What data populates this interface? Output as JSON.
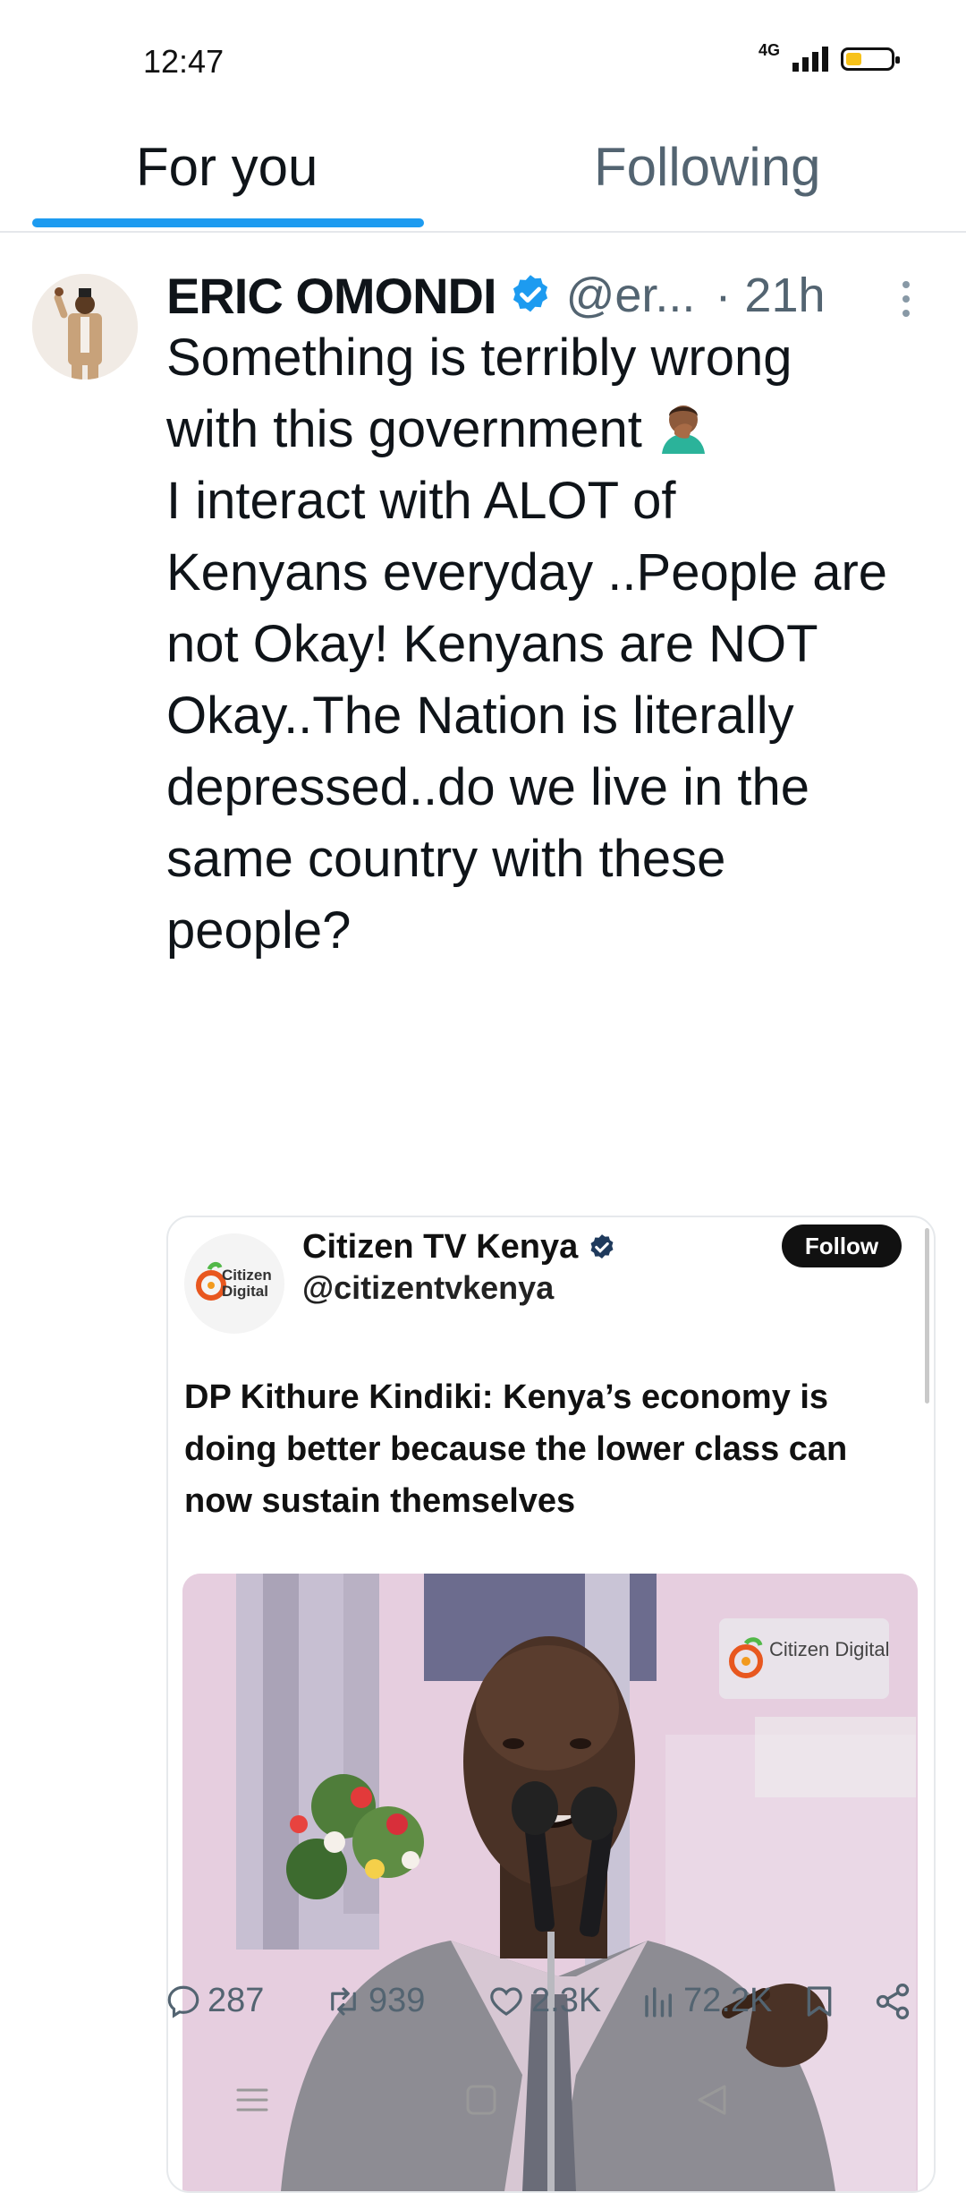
{
  "status_bar": {
    "time": "12:47",
    "network": "4G",
    "battery_level": 0.35,
    "battery_color": "#f7c21a"
  },
  "tabs": [
    {
      "label": "For you",
      "active": true
    },
    {
      "label": "Following",
      "active": false
    }
  ],
  "accent_color": "#1d9bf0",
  "tweet": {
    "author": "ERIC OMONDI",
    "handle": "@er...",
    "time": "· 21h",
    "verified_icon": "verified-badge-icon",
    "text_lines": [
      "Something is terribly wrong",
      "with this government",
      "I interact with ALOT of",
      "Kenyans everyday ..People are",
      "not Okay! Kenyans are NOT",
      "Okay..The Nation is literally",
      "depressed..do we live in the",
      "same country with these",
      "people?"
    ],
    "emoji": "face-palm-emoji",
    "embedded": {
      "name": "Citizen TV Kenya",
      "handle": "@citizentvkenya",
      "follow_label": "Follow",
      "logo_text": "Citizen Digital",
      "headline": "DP Kithure Kindiki: Kenya’s economy is doing better because the lower class can now sustain themselves",
      "photo_watermark": "Citizen Digital"
    },
    "actions": {
      "replies": "287",
      "retweets": "939",
      "likes": "2.3K",
      "views": "72.2K"
    }
  },
  "nav_bar": {
    "icons": [
      "menu-icon",
      "home-square-icon",
      "back-triangle-icon"
    ]
  }
}
